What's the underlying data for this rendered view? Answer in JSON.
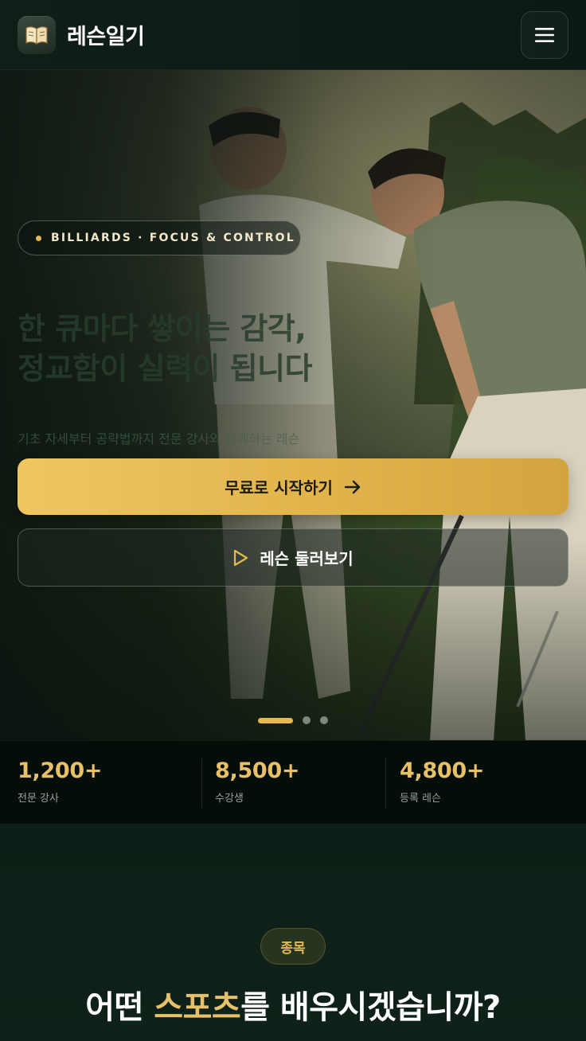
{
  "header": {
    "brand": "레슨일기",
    "logo_icon": "book-icon",
    "menu_icon": "hamburger-menu-icon"
  },
  "hero": {
    "badge": "BILLIARDS · FOCUS & CONTROL",
    "title_line1": "한 큐마다 쌓이는 감각,",
    "title_line2": "정교함이 실력이 됩니다",
    "subtitle": "기초 자세부터 공략법까지 전문 강사와 함께하는 레슨",
    "primary_button": "무료로 시작하기",
    "secondary_button": "레슨 둘러보기",
    "slides_total": 3,
    "slide_active": 1,
    "accent": "#e6b84f"
  },
  "stats": [
    {
      "value": "1,200+",
      "label": "전문 강사"
    },
    {
      "value": "8,500+",
      "label": "수강생"
    },
    {
      "value": "4,800+",
      "label": "등록 레슨"
    }
  ],
  "section": {
    "pill": "종목",
    "title_before": "어떤 ",
    "title_highlight": "스포츠",
    "title_after": "를 배우시겠습니까?"
  }
}
